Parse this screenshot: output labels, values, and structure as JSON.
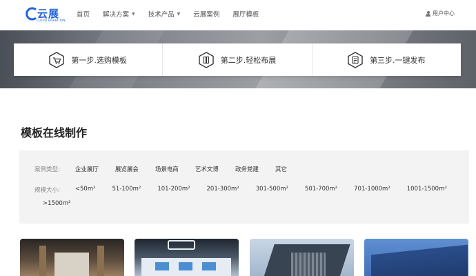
{
  "header": {
    "logo": {
      "name": "云展",
      "sub": "CLOUD EXHIBITION"
    },
    "nav": [
      {
        "label": "首页",
        "has_dropdown": false
      },
      {
        "label": "解决方案",
        "has_dropdown": true
      },
      {
        "label": "技术产品",
        "has_dropdown": true
      },
      {
        "label": "云展案例",
        "has_dropdown": false
      },
      {
        "label": "展厅模板",
        "has_dropdown": false
      }
    ],
    "user_center": "用户中心"
  },
  "steps": [
    {
      "label": "第一步.选购模板",
      "icon": "cart-hex-icon"
    },
    {
      "label": "第二步.轻松布展",
      "icon": "layout-hex-icon"
    },
    {
      "label": "第三步.一键发布",
      "icon": "publish-hex-icon"
    }
  ],
  "section": {
    "title": "模板在线制作"
  },
  "filters": {
    "type_label": "案例类型:",
    "types": [
      "企业展厅",
      "展览展会",
      "场景电商",
      "艺术文博",
      "政务党建",
      "其它"
    ],
    "size_label": "规模大小:",
    "sizes": [
      "<50m²",
      "51-100m²",
      "101-200m²",
      "201-300m²",
      "301-500m²",
      "501-700m²",
      "701-1000m²",
      "1001-1500m²",
      ">1500m²"
    ]
  },
  "colors": {
    "brand": "#1e62d7"
  }
}
